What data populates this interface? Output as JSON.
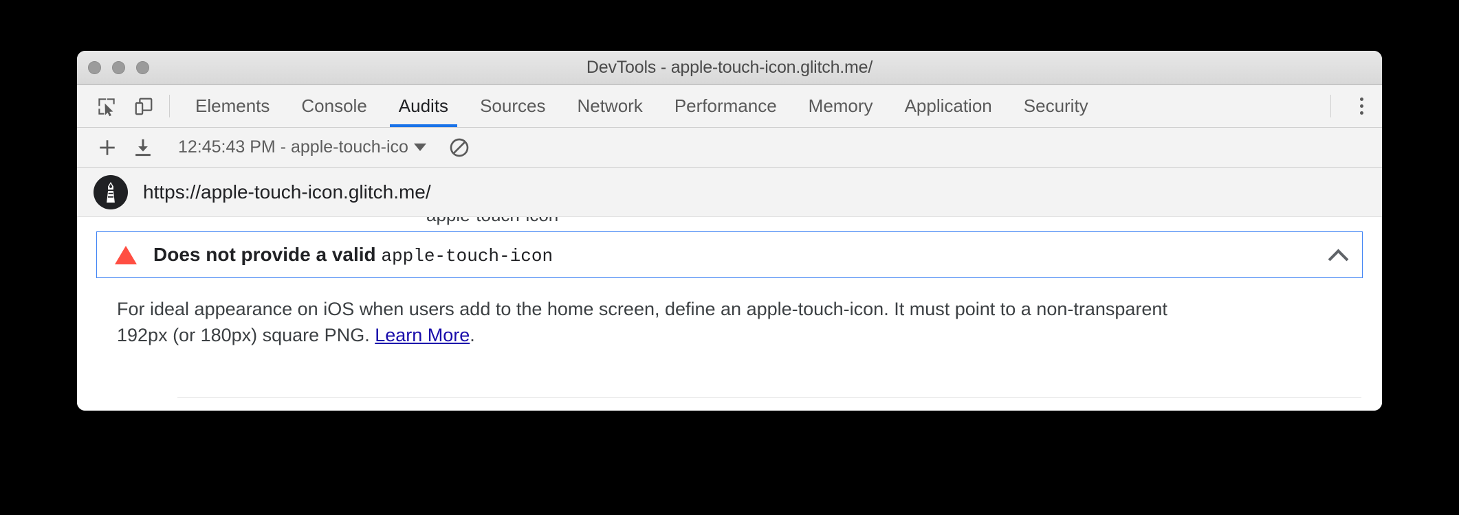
{
  "window": {
    "title": "DevTools - apple-touch-icon.glitch.me/",
    "traffic_lights": [
      "close",
      "minimize",
      "maximize"
    ]
  },
  "tabbar": {
    "left_icons": [
      {
        "name": "inspect-element-icon",
        "label": "Inspect element"
      },
      {
        "name": "device-toolbar-icon",
        "label": "Toggle device toolbar"
      }
    ],
    "tabs": [
      {
        "label": "Elements",
        "active": false
      },
      {
        "label": "Console",
        "active": false
      },
      {
        "label": "Audits",
        "active": true
      },
      {
        "label": "Sources",
        "active": false
      },
      {
        "label": "Network",
        "active": false
      },
      {
        "label": "Performance",
        "active": false
      },
      {
        "label": "Memory",
        "active": false
      },
      {
        "label": "Application",
        "active": false
      },
      {
        "label": "Security",
        "active": false
      }
    ],
    "more_label": "Customize and control DevTools"
  },
  "audit_toolbar": {
    "new_audit_label": "+",
    "download_label": "Export report",
    "report_select_value": "12:45:43 PM - apple-touch-ico",
    "clear_label": "Clear all"
  },
  "report_header": {
    "logo_name": "lighthouse-logo",
    "url": "https://apple-touch-icon.glitch.me/"
  },
  "report_body": {
    "clipped_text": "apple-touch-icon",
    "audit": {
      "status": "fail",
      "title_prefix": "Does not provide a valid ",
      "title_code": "apple-touch-icon",
      "expanded": true,
      "description_part1": "For ideal appearance on iOS when users add to the home screen, define an apple-touch-icon. It must point to a non-transparent 192px (or 180px) square PNG. ",
      "description_link": "Learn More",
      "description_part2": "."
    }
  },
  "colors": {
    "accent_blue": "#1a73e8",
    "border_blue": "#4285f4",
    "fail_red": "#ff4e42",
    "link_blue": "#1a0dab",
    "chrome_grey": "#f3f3f3"
  }
}
